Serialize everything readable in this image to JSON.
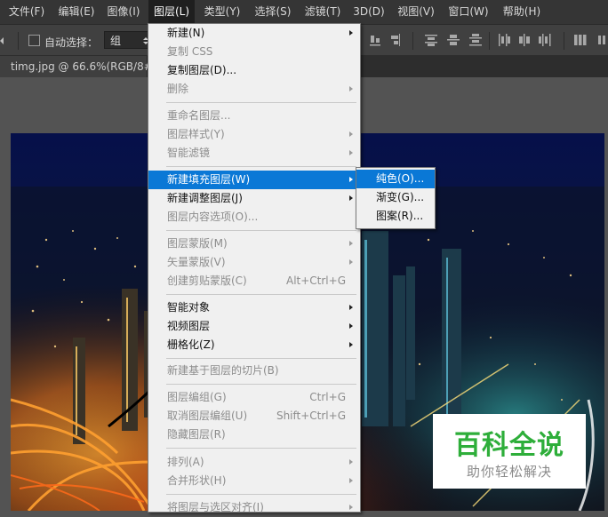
{
  "menubar": {
    "items": [
      {
        "label": "文件(F)"
      },
      {
        "label": "编辑(E)"
      },
      {
        "label": "图像(I)"
      },
      {
        "label": "图层(L)"
      },
      {
        "label": "类型(Y)"
      },
      {
        "label": "选择(S)"
      },
      {
        "label": "滤镜(T)"
      },
      {
        "label": "3D(D)"
      },
      {
        "label": "视图(V)"
      },
      {
        "label": "窗口(W)"
      },
      {
        "label": "帮助(H)"
      }
    ]
  },
  "options": {
    "auto_select_label": "自动选择：",
    "auto_select_value": "组"
  },
  "document_tab": {
    "label": "timg.jpg @ 66.6%(RGB/8#)"
  },
  "layer_menu": {
    "items": [
      {
        "label": "新建(N)",
        "shortcut": "",
        "submenu": true,
        "disabled": false
      },
      {
        "label": "复制 CSS",
        "shortcut": "",
        "submenu": false,
        "disabled": true
      },
      {
        "label": "复制图层(D)...",
        "shortcut": "",
        "submenu": false,
        "disabled": false
      },
      {
        "label": "删除",
        "shortcut": "",
        "submenu": true,
        "disabled": true
      },
      {
        "label": "重命名图层...",
        "shortcut": "",
        "submenu": false,
        "disabled": true
      },
      {
        "label": "图层样式(Y)",
        "shortcut": "",
        "submenu": true,
        "disabled": true
      },
      {
        "label": "智能滤镜",
        "shortcut": "",
        "submenu": true,
        "disabled": true
      },
      {
        "label": "新建填充图层(W)",
        "shortcut": "",
        "submenu": true,
        "disabled": false,
        "highlight": true
      },
      {
        "label": "新建调整图层(J)",
        "shortcut": "",
        "submenu": true,
        "disabled": false
      },
      {
        "label": "图层内容选项(O)...",
        "shortcut": "",
        "submenu": false,
        "disabled": true
      },
      {
        "label": "图层蒙版(M)",
        "shortcut": "",
        "submenu": true,
        "disabled": true
      },
      {
        "label": "矢量蒙版(V)",
        "shortcut": "",
        "submenu": true,
        "disabled": true
      },
      {
        "label": "创建剪贴蒙版(C)",
        "shortcut": "Alt+Ctrl+G",
        "submenu": false,
        "disabled": true
      },
      {
        "label": "智能对象",
        "shortcut": "",
        "submenu": true,
        "disabled": false
      },
      {
        "label": "视频图层",
        "shortcut": "",
        "submenu": true,
        "disabled": false
      },
      {
        "label": "栅格化(Z)",
        "shortcut": "",
        "submenu": true,
        "disabled": false
      },
      {
        "label": "新建基于图层的切片(B)",
        "shortcut": "",
        "submenu": false,
        "disabled": true
      },
      {
        "label": "图层编组(G)",
        "shortcut": "Ctrl+G",
        "submenu": false,
        "disabled": true
      },
      {
        "label": "取消图层编组(U)",
        "shortcut": "Shift+Ctrl+G",
        "submenu": false,
        "disabled": true
      },
      {
        "label": "隐藏图层(R)",
        "shortcut": "",
        "submenu": false,
        "disabled": true
      },
      {
        "label": "排列(A)",
        "shortcut": "",
        "submenu": true,
        "disabled": true
      },
      {
        "label": "合并形状(H)",
        "shortcut": "",
        "submenu": true,
        "disabled": true
      },
      {
        "label": "将图层与选区对齐(I)",
        "shortcut": "",
        "submenu": true,
        "disabled": true
      }
    ]
  },
  "fill_submenu": {
    "items": [
      {
        "label": "纯色(O)...",
        "highlight": true
      },
      {
        "label": "渐变(G)...",
        "highlight": false
      },
      {
        "label": "图案(R)...",
        "highlight": false
      }
    ]
  },
  "watermark": {
    "title": "百科全说",
    "subtitle": "助你轻松解决"
  },
  "colors": {
    "menu_highlight": "#0a78d6",
    "watermark_green": "#2eae3a"
  }
}
